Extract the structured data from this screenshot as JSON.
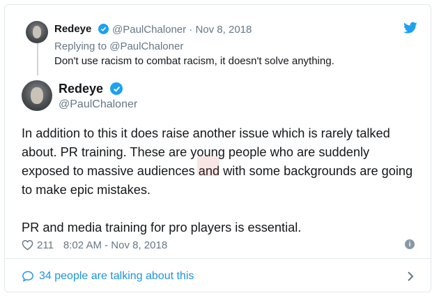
{
  "quoted_tweet": {
    "display_name": "Redeye",
    "handle_date": "@PaulChaloner · Nov 8, 2018",
    "replying_to": "Replying to @PaulChaloner",
    "text": "Don't use racism to combat racism, it doesn't solve anything."
  },
  "main_tweet": {
    "display_name": "Redeye",
    "handle": "@PaulChaloner",
    "paragraphs": [
      "In addition to this it does raise another issue which is rarely talked about. PR training. These are young people who are suddenly exposed to massive audiences and with some backgrounds are going to make epic mistakes.",
      "PR and media training for pro players is essential."
    ],
    "like_count": "211",
    "timestamp": "8:02 AM - Nov 8, 2018"
  },
  "footer": {
    "talking_text": "34 people are talking about this"
  },
  "colors": {
    "accent": "#1da1f2",
    "link": "#1b95e0",
    "muted": "#657786",
    "border": "#e1e8ed"
  },
  "icons": [
    "twitter-bird-icon",
    "verified-badge-icon",
    "heart-icon",
    "info-icon",
    "speech-bubble-icon",
    "chevron-right-icon"
  ]
}
